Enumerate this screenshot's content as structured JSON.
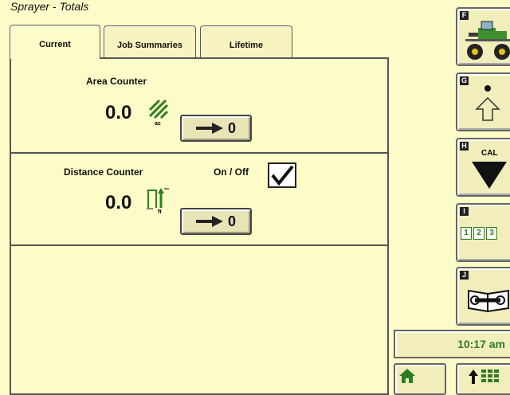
{
  "title": "Sprayer - Totals",
  "tabs": [
    {
      "label": "Current",
      "active": true
    },
    {
      "label": "Job Summaries",
      "active": false
    },
    {
      "label": "Lifetime",
      "active": false
    }
  ],
  "area_counter": {
    "label": "Area Counter",
    "value": "0.0",
    "unit": "ac",
    "reset_label": "0"
  },
  "distance_counter": {
    "label": "Distance Counter",
    "value": "0.0",
    "unit": "ft",
    "reset_label": "0",
    "toggle_label": "On / Off",
    "toggle_checked": true
  },
  "softkeys": [
    {
      "letter": "F",
      "icon": "tractor-sprayer-icon"
    },
    {
      "letter": "G",
      "icon": "up-arrow-icon"
    },
    {
      "letter": "H",
      "icon": "calibration-icon",
      "text": "CAL"
    },
    {
      "letter": "I",
      "icon": "numbered-pages-icon",
      "text": "1 2 3"
    },
    {
      "letter": "J",
      "icon": "service-manual-icon"
    }
  ],
  "clock": "10:17 am",
  "colors": {
    "background": "#fdfbc7",
    "accent_green": "#2e7d1f",
    "border": "#555555"
  }
}
